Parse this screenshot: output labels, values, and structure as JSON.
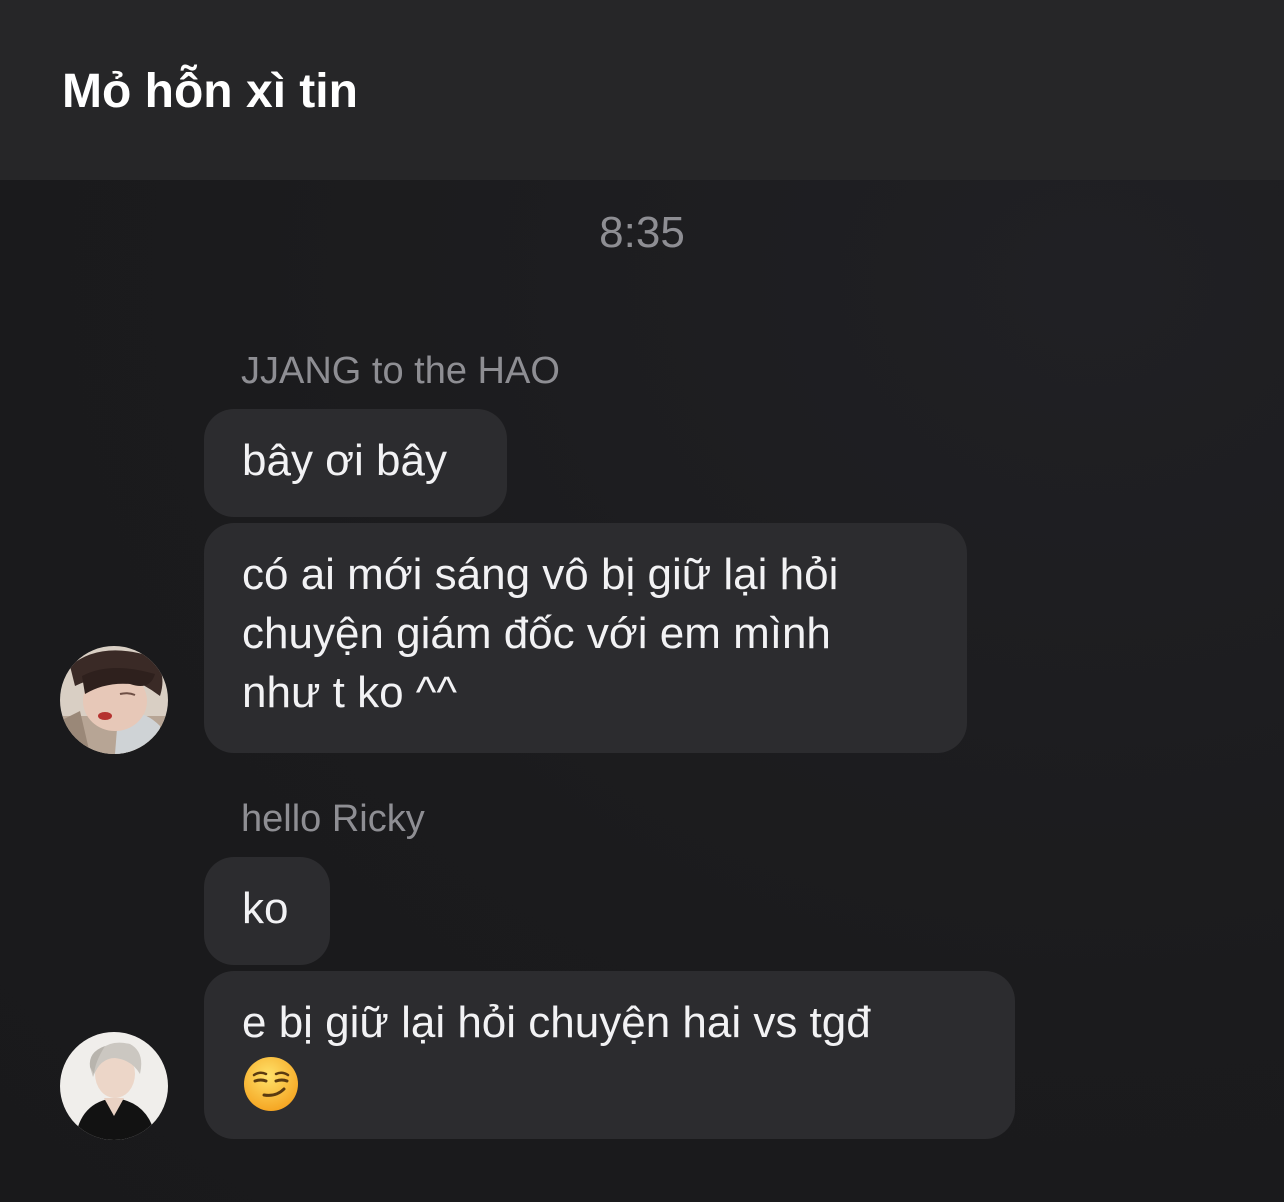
{
  "header": {
    "title": "Mỏ hỗn xì tin"
  },
  "chat": {
    "timestamp": "8:35",
    "groups": [
      {
        "sender": "JJANG to the HAO",
        "messages": [
          {
            "lines": [
              "bây ơi bây"
            ]
          },
          {
            "lines": [
              "có ai mới sáng vô bị giữ lại hỏi",
              "chuyện giám đốc với em mình",
              "như t ko ^^"
            ]
          }
        ],
        "avatar": "avatar-photo"
      },
      {
        "sender": "hello Ricky",
        "messages": [
          {
            "lines": [
              "ko"
            ]
          },
          {
            "lines": [
              "e bị giữ lại hỏi chuyện hai vs tgđ"
            ],
            "emoji": "smirking-face-emoji"
          }
        ],
        "avatar": "avatar-photo"
      }
    ]
  }
}
